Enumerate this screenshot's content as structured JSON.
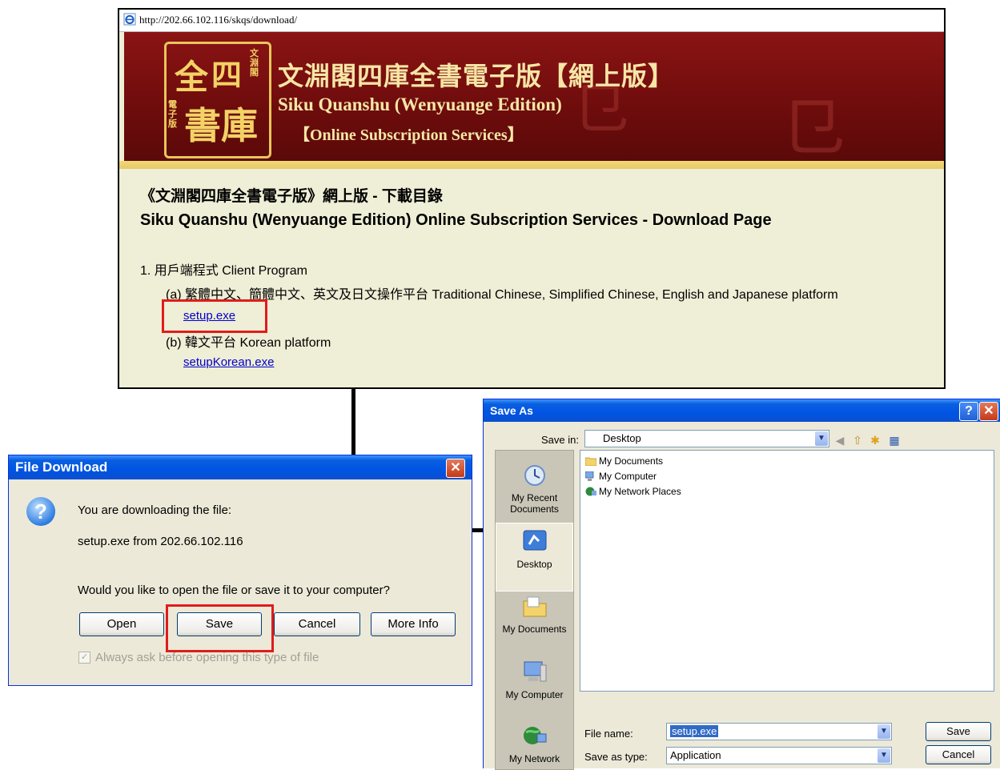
{
  "browser": {
    "url": "http://202.66.102.116/skqs/download/",
    "banner": {
      "seal_chars": [
        "全",
        "四",
        "書",
        "庫",
        "文淵閣",
        "電子版"
      ],
      "title_cn": "文淵閣四庫全書電子版【網上版】",
      "title_en": "Siku Quanshu (Wenyuange Edition)",
      "subtitle_en": "【Online Subscription Services】"
    },
    "heading_cn": "《文淵閣四庫全書電子版》網上版 - 下載目錄",
    "heading_en": "Siku Quanshu (Wenyuange Edition) Online Subscription Services - Download Page",
    "section1": "1. 用戶端程式 Client Program",
    "item_a": "(a) 繁體中文、簡體中文、英文及日文操作平台 Traditional Chinese, Simplified Chinese, English and Japanese platform",
    "link_a": "setup.exe",
    "item_b": "(b) 韓文平台 Korean platform",
    "link_b": "setupKorean.exe"
  },
  "file_download": {
    "title": "File Download",
    "line1": "You are downloading the file:",
    "line2": "setup.exe from 202.66.102.116",
    "question": "Would you like to open the file or save it to your computer?",
    "buttons": {
      "open": "Open",
      "save": "Save",
      "cancel": "Cancel",
      "more_info": "More Info"
    },
    "checkbox_label": "Always ask before opening this type of file",
    "checkbox_checked": true,
    "close_glyph": "✕"
  },
  "save_as": {
    "title": "Save As",
    "help_glyph": "?",
    "close_glyph": "✕",
    "save_in_label": "Save in:",
    "save_in_value": "Desktop",
    "places": [
      "My Recent Documents",
      "Desktop",
      "My Documents",
      "My Computer",
      "My Network"
    ],
    "files": [
      "My Documents",
      "My Computer",
      "My Network Places"
    ],
    "file_name_label": "File name:",
    "file_name_value": "setup.exe",
    "save_type_label": "Save as type:",
    "save_type_value": "Application",
    "save_button": "Save",
    "cancel_button": "Cancel"
  },
  "colors": {
    "highlight_box": "#e01c1c",
    "banner_red": "#6e0c0c",
    "xp_title_blue": "#0054e3",
    "link_blue": "#0000cc"
  }
}
